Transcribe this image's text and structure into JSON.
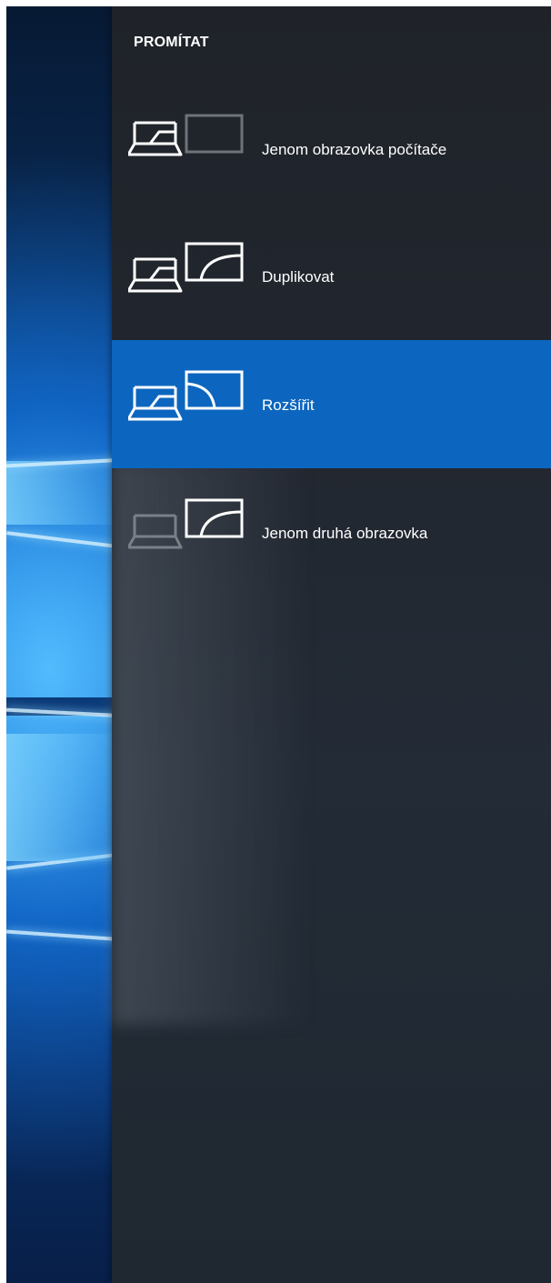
{
  "panel": {
    "title": "PROMÍTAT"
  },
  "options": [
    {
      "label": "Jenom obrazovka počítače",
      "icon": "pc-screen-only-icon",
      "selected": false
    },
    {
      "label": "Duplikovat",
      "icon": "duplicate-icon",
      "selected": false
    },
    {
      "label": "Rozšířit",
      "icon": "extend-icon",
      "selected": true
    },
    {
      "label": "Jenom druhá obrazovka",
      "icon": "second-screen-only-icon",
      "selected": false
    }
  ],
  "colors": {
    "selected_background": "#0c66bf",
    "panel_background": "#222730",
    "text": "#ffffff"
  }
}
